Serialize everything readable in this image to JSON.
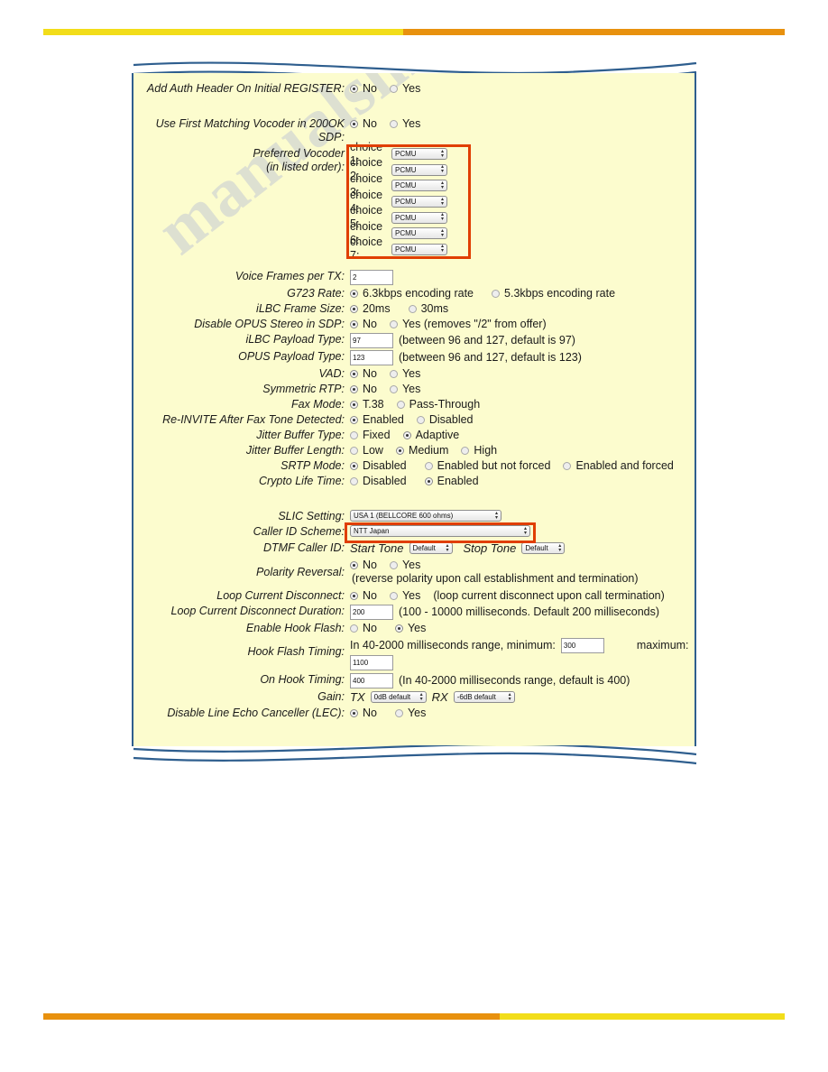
{
  "page": {
    "watermark": "manualshive.com",
    "accent_yellow": "#F2DD1A",
    "accent_orange": "#E8910E",
    "panel_bg": "#FCFCCE",
    "border_blue": "#2E5E8E",
    "highlight_red": "#E03E00"
  },
  "form": {
    "add_auth_header": {
      "label": "Add Auth Header On Initial REGISTER:",
      "options": [
        "No",
        "Yes"
      ],
      "selected": "No"
    },
    "use_first_matching_vocoder": {
      "label": "Use First Matching Vocoder in 200OK SDP:",
      "options": [
        "No",
        "Yes"
      ],
      "selected": "No"
    },
    "preferred_vocoder": {
      "label_line1": "Preferred Vocoder",
      "label_line2": "(in listed order):",
      "choices": [
        {
          "name": "choice 1:",
          "value": "PCMU"
        },
        {
          "name": "choice 2:",
          "value": "PCMU"
        },
        {
          "name": "choice 3:",
          "value": "PCMU"
        },
        {
          "name": "choice 4:",
          "value": "PCMU"
        },
        {
          "name": "choice 5:",
          "value": "PCMU"
        },
        {
          "name": "choice 6:",
          "value": "PCMU"
        },
        {
          "name": "choice 7:",
          "value": "PCMU"
        }
      ]
    },
    "voice_frames_per_tx": {
      "label": "Voice Frames per TX:",
      "value": "2"
    },
    "g723_rate": {
      "label": "G723 Rate:",
      "options": [
        "6.3kbps encoding rate",
        "5.3kbps encoding rate"
      ],
      "selected": "6.3kbps encoding rate"
    },
    "ilbc_frame_size": {
      "label": "iLBC Frame Size:",
      "options": [
        "20ms",
        "30ms"
      ],
      "selected": "20ms"
    },
    "disable_opus_stereo": {
      "label": "Disable OPUS Stereo in SDP:",
      "options": [
        "No",
        "Yes (removes \"/2\" from offer)"
      ],
      "selected": "No"
    },
    "ilbc_payload_type": {
      "label": "iLBC Payload Type:",
      "value": "97",
      "hint": "(between 96 and 127, default is 97)"
    },
    "opus_payload_type": {
      "label": "OPUS Payload Type:",
      "value": "123",
      "hint": "(between 96 and 127, default is 123)"
    },
    "vad": {
      "label": "VAD:",
      "options": [
        "No",
        "Yes"
      ],
      "selected": "No"
    },
    "symmetric_rtp": {
      "label": "Symmetric RTP:",
      "options": [
        "No",
        "Yes"
      ],
      "selected": "No"
    },
    "fax_mode": {
      "label": "Fax Mode:",
      "options": [
        "T.38",
        "Pass-Through"
      ],
      "selected": "T.38"
    },
    "reinvite_after_fax_tone": {
      "label": "Re-INVITE After Fax Tone Detected:",
      "options": [
        "Enabled",
        "Disabled"
      ],
      "selected": "Enabled"
    },
    "jitter_buffer_type": {
      "label": "Jitter Buffer Type:",
      "options": [
        "Fixed",
        "Adaptive"
      ],
      "selected": "Adaptive"
    },
    "jitter_buffer_length": {
      "label": "Jitter Buffer Length:",
      "options": [
        "Low",
        "Medium",
        "High"
      ],
      "selected": "Medium"
    },
    "srtp_mode": {
      "label": "SRTP Mode:",
      "options": [
        "Disabled",
        "Enabled but not forced",
        "Enabled and forced"
      ],
      "selected": "Disabled"
    },
    "crypto_life_time": {
      "label": "Crypto Life Time:",
      "options": [
        "Disabled",
        "Enabled"
      ],
      "selected": "Enabled"
    },
    "slic_setting": {
      "label": "SLIC Setting:",
      "value": "USA 1 (BELLCORE 600 ohms)"
    },
    "caller_id_scheme": {
      "label": "Caller ID Scheme:",
      "value": "NTT Japan"
    },
    "dtmf_caller_id": {
      "label": "DTMF Caller ID:",
      "start_tone_label": "Start Tone",
      "start_tone_value": "Default",
      "stop_tone_label": "Stop Tone",
      "stop_tone_value": "Default"
    },
    "polarity_reversal": {
      "label": "Polarity Reversal:",
      "options": [
        "No",
        "Yes"
      ],
      "selected": "No",
      "hint": "(reverse polarity upon call establishment and termination)"
    },
    "loop_current_disconnect": {
      "label": "Loop Current Disconnect:",
      "options": [
        "No",
        "Yes"
      ],
      "selected": "No",
      "hint": "(loop current disconnect upon call termination)"
    },
    "loop_current_disconnect_duration": {
      "label": "Loop Current Disconnect Duration:",
      "value": "200",
      "hint": "(100 - 10000 milliseconds. Default 200 milliseconds)"
    },
    "enable_hook_flash": {
      "label": "Enable Hook Flash:",
      "options": [
        "No",
        "Yes"
      ],
      "selected": "Yes"
    },
    "hook_flash_timing": {
      "label": "Hook Flash Timing:",
      "prefix": "In 40-2000 milliseconds range, minimum:",
      "min_value": "300",
      "max_label": "maximum:",
      "max_value": "1100"
    },
    "on_hook_timing": {
      "label": "On Hook Timing:",
      "value": "400",
      "hint": "(In 40-2000 milliseconds range, default is 400)"
    },
    "gain": {
      "label": "Gain:",
      "tx_label": "TX",
      "tx_value": "0dB default",
      "rx_label": "RX",
      "rx_value": "-6dB default"
    },
    "disable_lec": {
      "label": "Disable Line Echo Canceller (LEC):",
      "options": [
        "No",
        "Yes"
      ],
      "selected": "No"
    }
  }
}
